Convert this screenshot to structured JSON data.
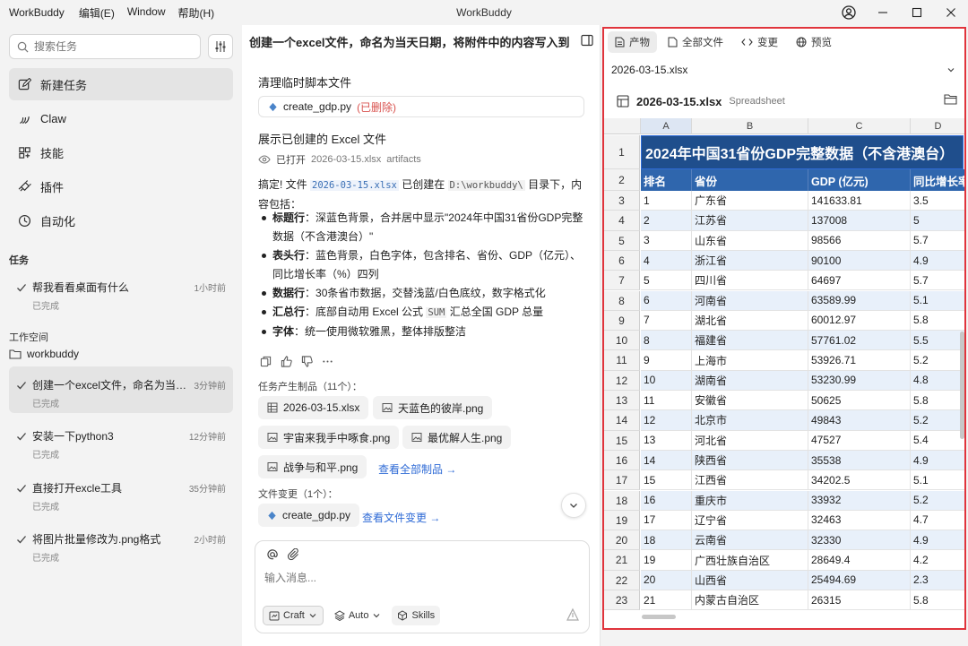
{
  "titlebar": {
    "app_name": "WorkBuddy",
    "menus": [
      "编辑(E)",
      "Window",
      "帮助(H)"
    ],
    "window_title": "WorkBuddy"
  },
  "sidebar": {
    "search_placeholder": "搜索任务",
    "nav": [
      {
        "label": "新建任务",
        "icon": "edit-icon",
        "active": true
      },
      {
        "label": "Claw",
        "icon": "claw-icon",
        "active": false
      },
      {
        "label": "技能",
        "icon": "skills-icon",
        "active": false
      },
      {
        "label": "插件",
        "icon": "plugin-icon",
        "active": false
      },
      {
        "label": "自动化",
        "icon": "clock-icon",
        "active": false
      }
    ],
    "tasks_title": "任务",
    "tasks": [
      {
        "name": "帮我看看桌面有什么",
        "time": "1小时前",
        "status": "已完成"
      }
    ],
    "workspace_title": "工作空间",
    "workspace_name": "workbuddy",
    "workspace_tasks": [
      {
        "name": "创建一个excel文件，命名为当天...",
        "time": "3分钟前",
        "status": "已完成",
        "active": true
      },
      {
        "name": "安装一下python3",
        "time": "12分钟前",
        "status": "已完成",
        "active": false
      },
      {
        "name": "直接打开excle工具",
        "time": "35分钟前",
        "status": "已完成",
        "active": false
      },
      {
        "name": "将图片批量修改为.png格式",
        "time": "2小时前",
        "status": "已完成",
        "active": false
      }
    ]
  },
  "chat": {
    "title": "创建一个excel文件，命名为当天日期，将附件中的内容写入到",
    "step_cleanup": "清理临时脚本文件",
    "script_file": "create_gdp.py",
    "deleted_tag": "(已删除)",
    "step_show": "展示已创建的 Excel 文件",
    "opened_label": "已打开",
    "opened_file": "2026-03-15.xlsx",
    "opened_suffix": "artifacts",
    "summary_pre": "搞定! 文件",
    "summary_file": "2026-03-15.xlsx",
    "summary_mid": "已创建在",
    "summary_path": "D:\\workbuddy\\",
    "summary_post": "目录下，内",
    "summary_line2": "容包括：",
    "bullets": [
      {
        "label": "标题行",
        "text": "：深蓝色背景，合并居中显示\"2024年中国31省份GDP完整数据（不含港澳台）\""
      },
      {
        "label": "表头行",
        "text": "：蓝色背景，白色字体，包含排名、省份、GDP（亿元）、同比增长率（%）四列"
      },
      {
        "label": "数据行",
        "text": "：30条省市数据，交替浅蓝/白色底纹，数字格式化"
      },
      {
        "label": "汇总行",
        "text_pre": "：底部自动用 Excel 公式",
        "code": "SUM",
        "text": "汇总全国 GDP 总量"
      },
      {
        "label": "字体",
        "text": "：统一使用微软雅黑，整体排版整洁"
      }
    ],
    "artifacts_label": "任务产生制品（11个）：",
    "artifacts": [
      "2026-03-15.xlsx",
      "天蓝色的彼岸.png",
      "宇宙来我手中啄食.png",
      "最优解人生.png",
      "战争与和平.png"
    ],
    "view_all_artifacts": "查看全部制品 →",
    "file_changes_label": "文件变更（1个）：",
    "changed_file": "create_gdp.py",
    "view_changes": "查看文件变更 →",
    "composer_placeholder": "输入消息...",
    "mode_label": "Craft",
    "auto_label": "Auto",
    "skills_label": "Skills"
  },
  "right": {
    "tabs": [
      {
        "label": "产物",
        "icon": "document-icon",
        "active": true
      },
      {
        "label": "全部文件",
        "icon": "file-icon",
        "active": false
      },
      {
        "label": "变更",
        "icon": "code-icon",
        "active": false
      },
      {
        "label": "预览",
        "icon": "globe-icon",
        "active": false
      }
    ],
    "selected_file": "2026-03-15.xlsx",
    "doc_name": "2026-03-15.xlsx",
    "doc_type": "Spreadsheet",
    "columns": [
      "A",
      "B",
      "C",
      "D"
    ],
    "sheet_title": "2024年中国31省份GDP完整数据（不含港澳台）",
    "headers": [
      "排名",
      "省份",
      "GDP (亿元)",
      "同比增长率"
    ],
    "rows": [
      [
        "1",
        "广东省",
        "141633.81",
        "3.5"
      ],
      [
        "2",
        "江苏省",
        "137008",
        "5"
      ],
      [
        "3",
        "山东省",
        "98566",
        "5.7"
      ],
      [
        "4",
        "浙江省",
        "90100",
        "4.9"
      ],
      [
        "5",
        "四川省",
        "64697",
        "5.7"
      ],
      [
        "6",
        "河南省",
        "63589.99",
        "5.1"
      ],
      [
        "7",
        "湖北省",
        "60012.97",
        "5.8"
      ],
      [
        "8",
        "福建省",
        "57761.02",
        "5.5"
      ],
      [
        "9",
        "上海市",
        "53926.71",
        "5.2"
      ],
      [
        "10",
        "湖南省",
        "53230.99",
        "4.8"
      ],
      [
        "11",
        "安徽省",
        "50625",
        "5.8"
      ],
      [
        "12",
        "北京市",
        "49843",
        "5.2"
      ],
      [
        "13",
        "河北省",
        "47527",
        "5.4"
      ],
      [
        "14",
        "陕西省",
        "35538",
        "4.9"
      ],
      [
        "15",
        "江西省",
        "34202.5",
        "5.1"
      ],
      [
        "16",
        "重庆市",
        "33932",
        "5.2"
      ],
      [
        "17",
        "辽宁省",
        "32463",
        "4.7"
      ],
      [
        "18",
        "云南省",
        "32330",
        "4.9"
      ],
      [
        "19",
        "广西壮族自治区",
        "28649.4",
        "4.2"
      ],
      [
        "20",
        "山西省",
        "25494.69",
        "2.3"
      ],
      [
        "21",
        "内蒙古自治区",
        "26315",
        "5.8"
      ]
    ],
    "colors": {
      "title_bg": "#1f4e8c",
      "header_bg": "#2f66ad",
      "alt_row": "#e8f0fa",
      "highlight": "#e0343c"
    }
  }
}
